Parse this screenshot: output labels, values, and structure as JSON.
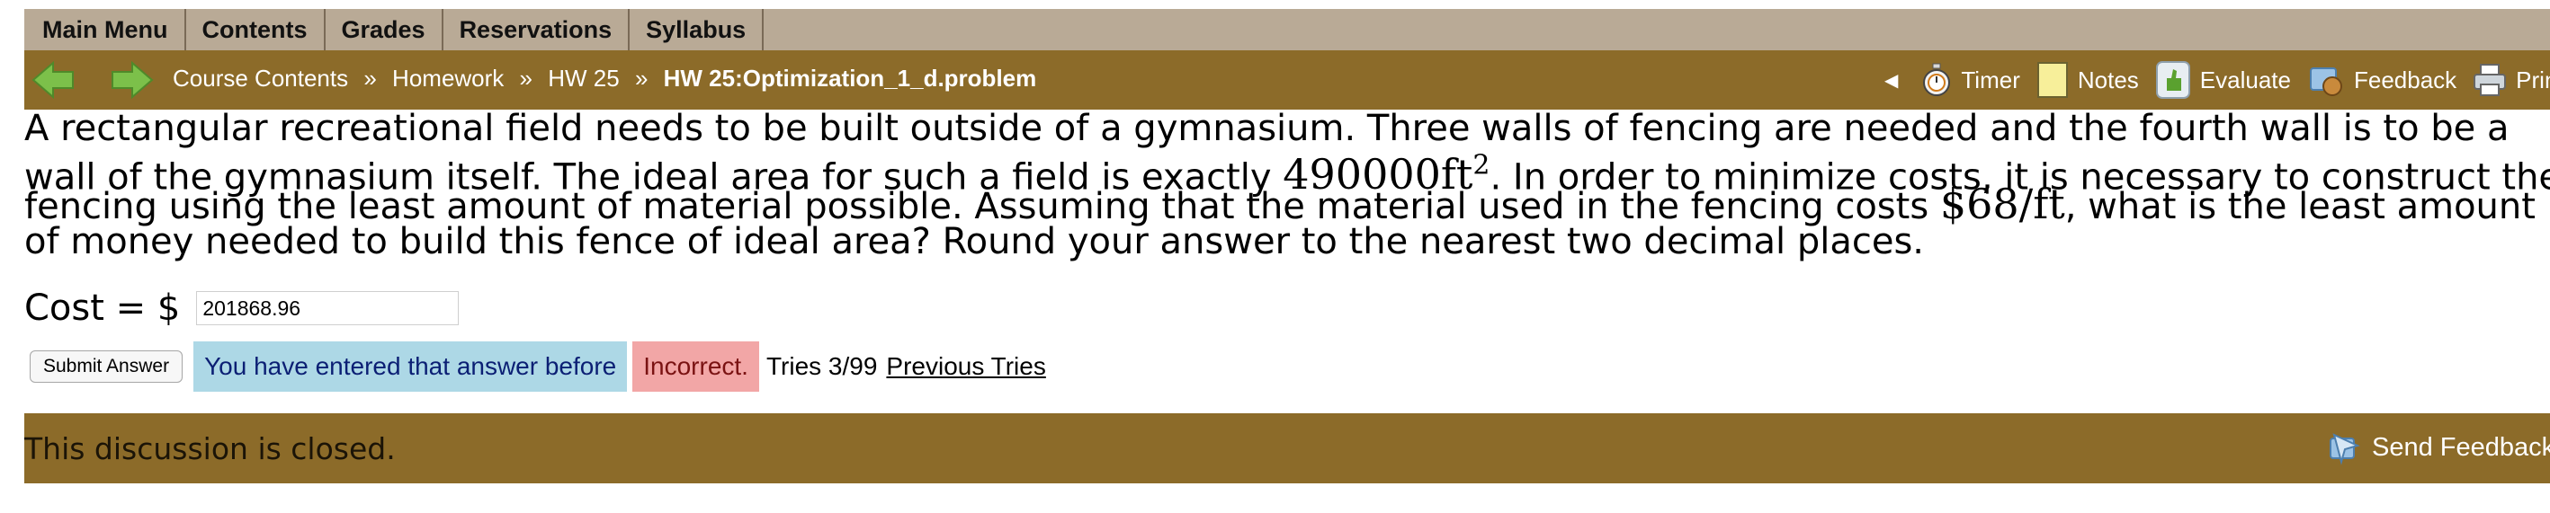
{
  "menu": {
    "items": [
      "Main Menu",
      "Contents",
      "Grades",
      "Reservations",
      "Syllabus"
    ]
  },
  "nav": {
    "breadcrumbs": [
      "Course Contents",
      "Homework",
      "HW 25"
    ],
    "separator": "»",
    "current": "HW 25:Optimization_1_d.problem",
    "tools": {
      "timer": "Timer",
      "notes": "Notes",
      "evaluate": "Evaluate",
      "feedback": "Feedback",
      "print": "Print"
    }
  },
  "problem": {
    "line1": "A rectangular recreational field needs to be built outside of a gymnasium. Three walls of fencing are needed and the fourth wall is to be a",
    "line2_pre": "wall of the gymnasium itself. The ideal area for such a field is exactly ",
    "area_value": "490000ft",
    "area_exp": "2",
    "line2_post": ". In order to minimize costs, it is necessary to construct the",
    "line3_pre": "fencing using the least amount of material possible. Assuming that the material used in the fencing costs ",
    "cost_rate": "$68/ft",
    "line3_post": ", what is the least amount",
    "line4": "of money needed to build this fence of ideal area? Round your answer to the nearest two decimal places."
  },
  "answer": {
    "label": "Cost = $",
    "value": "201868.96"
  },
  "status": {
    "submit_label": "Submit Answer",
    "previous_message": "You have entered that answer before",
    "result": "Incorrect.",
    "tries": "Tries 3/99",
    "previous_tries_link": "Previous Tries"
  },
  "discussion": {
    "message": "This discussion is closed.",
    "send_feedback": "Send Feedback"
  },
  "colors": {
    "menu_bg": "#b9aa96",
    "nav_bg": "#8c6b29",
    "prev_badge": "#add8e6",
    "incorrect_badge": "#f2a6a6"
  }
}
